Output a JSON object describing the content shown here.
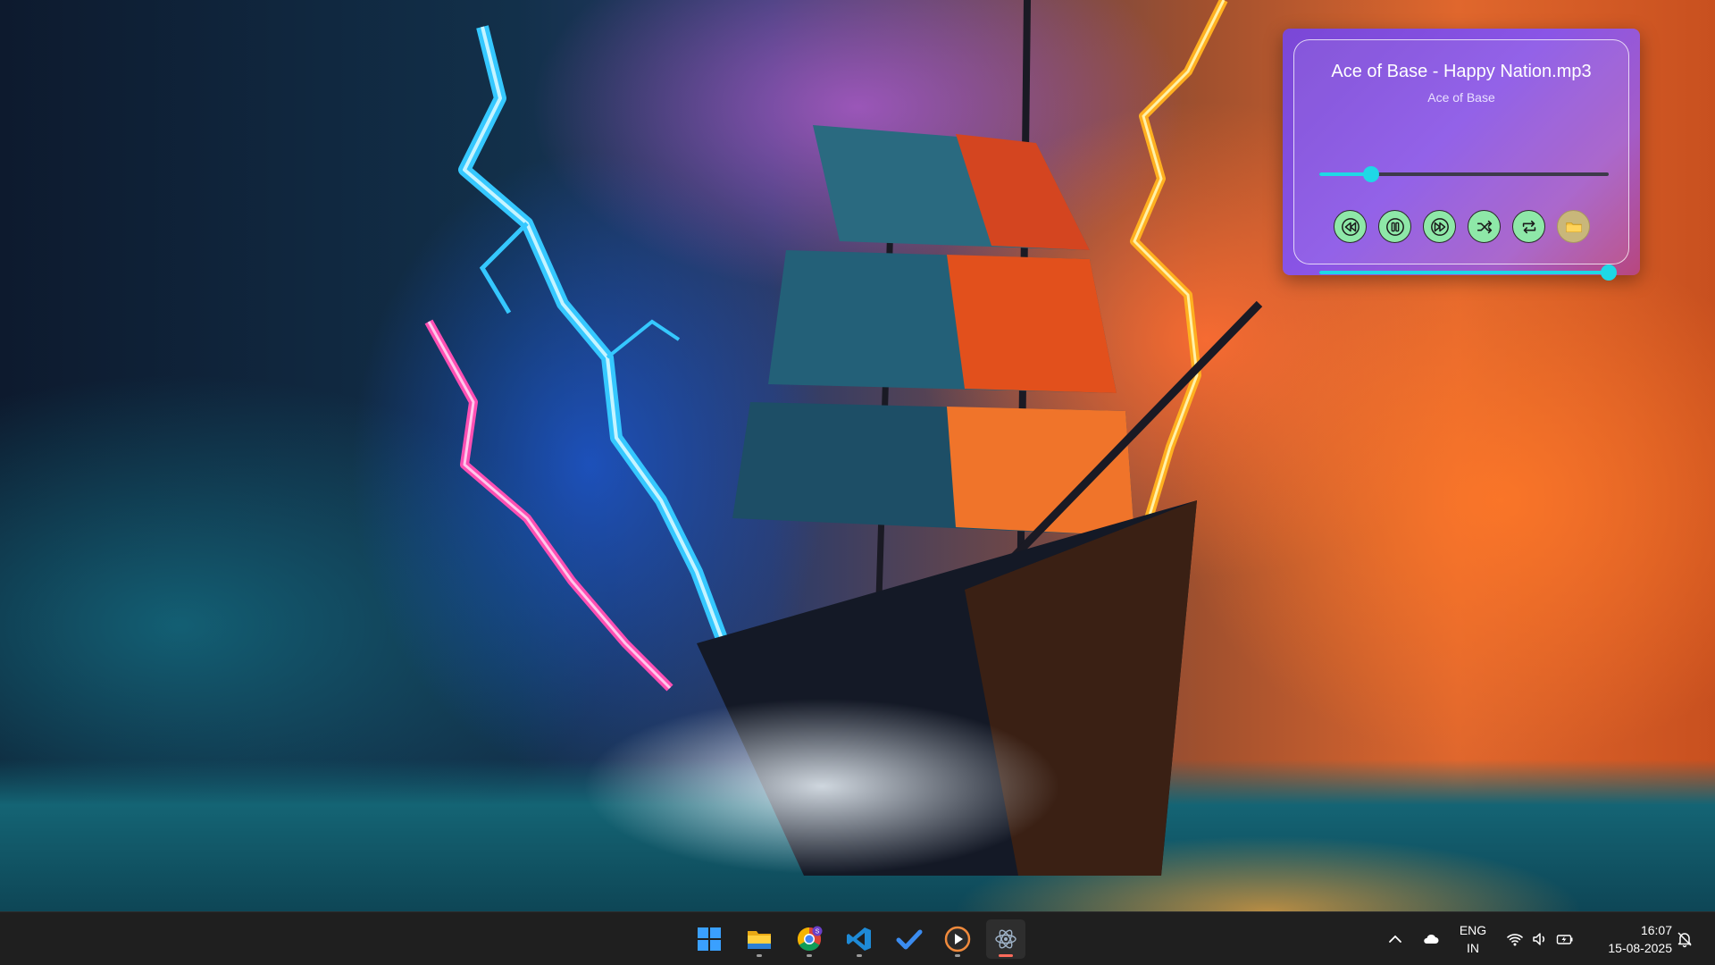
{
  "player": {
    "title": "Ace of Base - Happy Nation.mp3",
    "artist": "Ace of Base",
    "progress_fraction": 0.18,
    "volume_fraction": 1.0,
    "controls": [
      "rewind-icon",
      "pause-icon",
      "fast-forward-icon",
      "shuffle-icon",
      "repeat-icon",
      "folder-icon"
    ],
    "accent_color": "#1ed8e6",
    "button_color": "#8ee8a8"
  },
  "taskbar": {
    "apps": [
      "windows-start",
      "file-explorer",
      "google-chrome",
      "visual-studio-code",
      "microsoft-todo",
      "media-player",
      "electron-app"
    ],
    "tray": {
      "lang_line1": "ENG",
      "lang_line2": "IN",
      "time": "16:07",
      "date": "15-08-2025"
    },
    "chrome_profile_badge": "S"
  }
}
